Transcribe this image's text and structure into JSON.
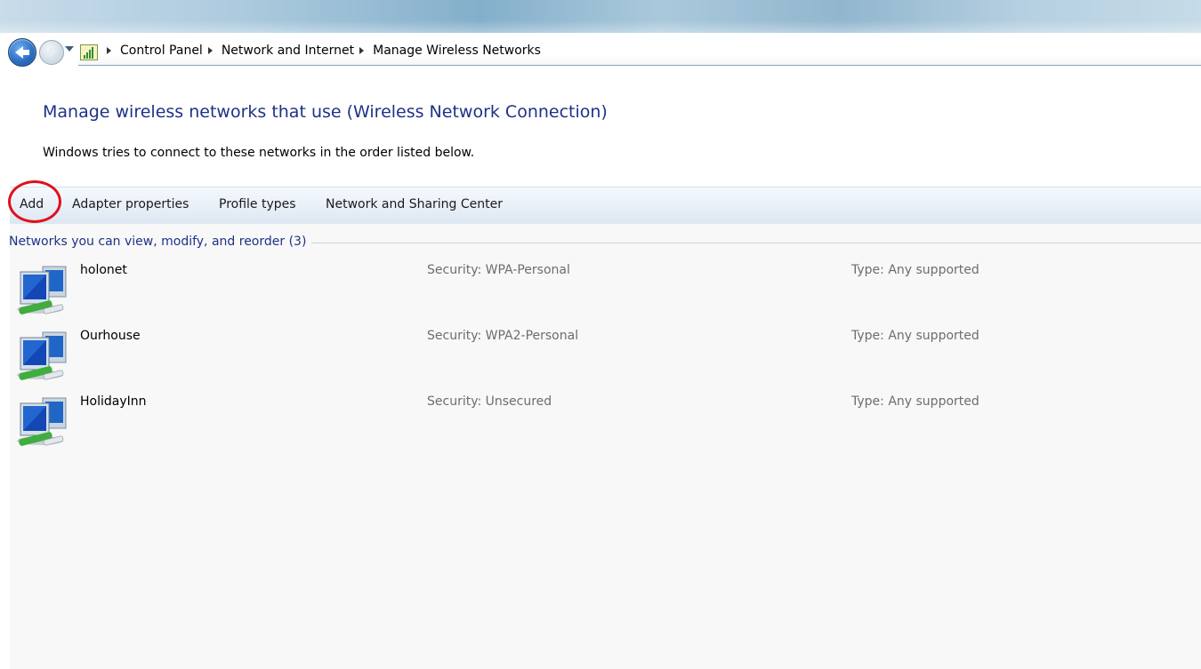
{
  "address_bar": {
    "crumbs": [
      "Control Panel",
      "Network and Internet",
      "Manage Wireless Networks"
    ]
  },
  "page": {
    "heading": "Manage wireless networks that use (Wireless Network Connection)",
    "subtext": "Windows tries to connect to these networks in the order listed below."
  },
  "toolbar": {
    "add": "Add",
    "adapter_properties": "Adapter properties",
    "profile_types": "Profile types",
    "network_sharing_center": "Network and Sharing Center"
  },
  "list": {
    "group_header": "Networks you can view, modify, and reorder (3)",
    "networks": [
      {
        "name": "holonet",
        "security": "Security: WPA-Personal",
        "type": "Type: Any supported"
      },
      {
        "name": "Ourhouse",
        "security": "Security: WPA2-Personal",
        "type": "Type: Any supported"
      },
      {
        "name": "HolidayInn",
        "security": "Security: Unsecured",
        "type": "Type: Any supported"
      }
    ]
  },
  "colors": {
    "heading_blue": "#1e3287",
    "annotation_red": "#e1101a",
    "muted_text": "#6d6d6d"
  },
  "icons": {
    "back": "back-arrow-icon",
    "forward": "forward-arrow-icon",
    "location": "network-control-panel-icon",
    "network": "wireless-network-computers-icon"
  }
}
